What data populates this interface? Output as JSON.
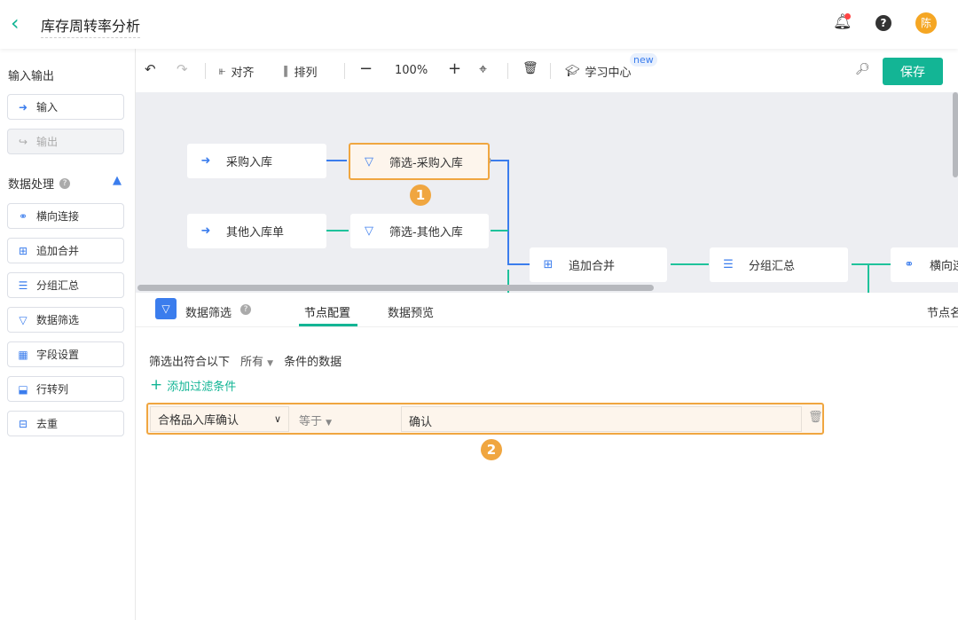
{
  "header": {
    "title": "库存周转率分析",
    "avatar": "陈"
  },
  "sidebar": {
    "io_heading": "输入输出",
    "io_items": [
      {
        "label": "输入",
        "icon": "arrow-in-icon"
      },
      {
        "label": "输出",
        "icon": "arrow-out-icon",
        "disabled": true
      }
    ],
    "proc_heading": "数据处理",
    "proc_items": [
      {
        "label": "横向连接",
        "icon": "link-icon"
      },
      {
        "label": "追加合并",
        "icon": "merge-icon"
      },
      {
        "label": "分组汇总",
        "icon": "list-icon"
      },
      {
        "label": "数据筛选",
        "icon": "filter-icon"
      },
      {
        "label": "字段设置",
        "icon": "table-icon"
      },
      {
        "label": "行转列",
        "icon": "pivot-icon"
      },
      {
        "label": "去重",
        "icon": "dedupe-icon"
      }
    ]
  },
  "toolbar": {
    "align": "对齐",
    "arrange": "排列",
    "zoom": "100%",
    "learn": "学习中心",
    "new_badge": "new",
    "save": "保存"
  },
  "canvas": {
    "nodes": [
      "采购入库",
      "筛选-采购入库",
      "其他入库单",
      "筛选-其他入库",
      "追加合并",
      "分组汇总",
      "横向连接"
    ],
    "markers": [
      "1",
      "2"
    ]
  },
  "panel": {
    "node_type": "数据筛选",
    "tabs": [
      "节点配置",
      "数据预览"
    ],
    "right_tab": "节点名",
    "filter_prefix": "筛选出符合以下",
    "filter_mode": "所有",
    "filter_suffix": "条件的数据",
    "add_condition": "添加过滤条件",
    "condition": {
      "field": "合格品入库确认",
      "operator": "等于",
      "value": "确认"
    }
  },
  "colors": {
    "accent": "#13b595",
    "highlight": "#f0a640",
    "icon_blue": "#3b7ded"
  }
}
